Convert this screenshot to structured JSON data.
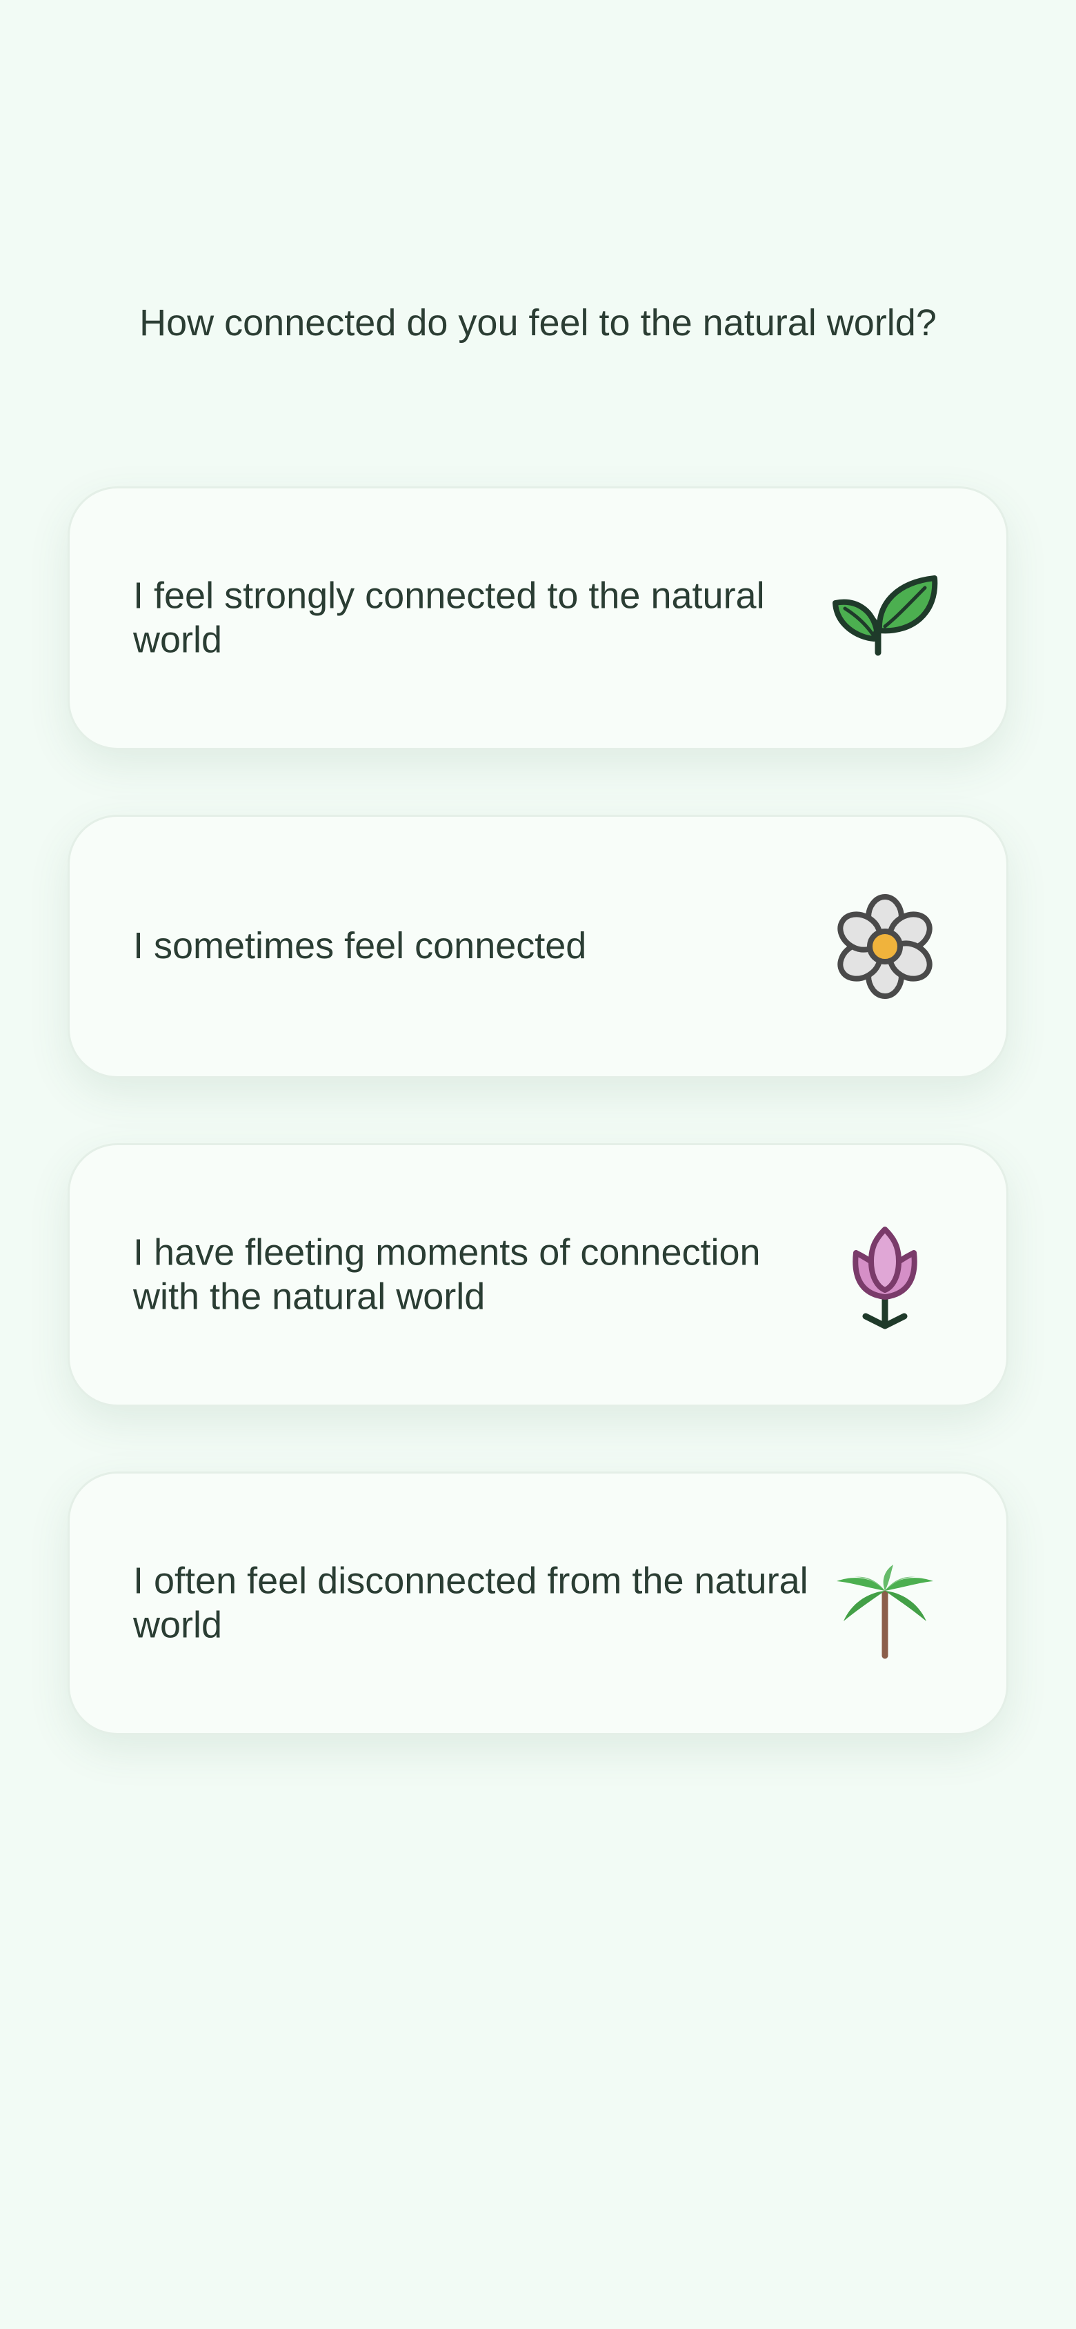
{
  "question": {
    "text": "How connected do you feel to the natural world?"
  },
  "options": [
    {
      "label": "I feel strongly connected to the natural world",
      "icon": "sprout-icon"
    },
    {
      "label": "I sometimes feel connected",
      "icon": "daisy-icon"
    },
    {
      "label": "I have fleeting moments of connection with the natural world",
      "icon": "tulip-icon"
    },
    {
      "label": "I often feel disconnected from the natural world",
      "icon": "palm-tree-icon"
    }
  ],
  "colors": {
    "background": "#f2fbf5",
    "card": "#f8fdf9",
    "text": "#2a3d33",
    "leaf_green": "#4caf50",
    "outline": "#1f3a2a",
    "tulip_pink": "#d58fc7",
    "daisy_center": "#f0b33c",
    "trunk_brown": "#8b5e4a"
  }
}
